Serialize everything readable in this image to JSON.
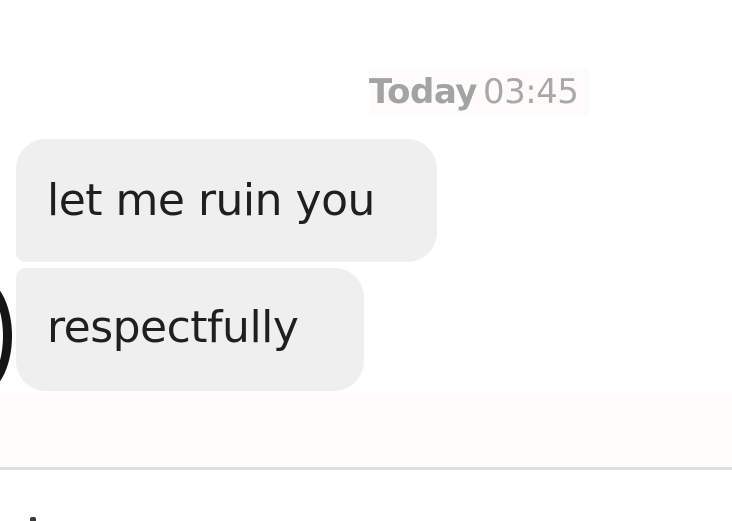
{
  "conversation": {
    "timestamp": {
      "day": "Today",
      "time": "03:45"
    },
    "messages": [
      {
        "text": "let me ruin you"
      },
      {
        "text": "respectfully"
      }
    ]
  },
  "colors": {
    "incoming_bubble": "#efefef",
    "message_text": "#1f1f1f",
    "timestamp_text": "#a3a3a3",
    "divider": "#dedede"
  },
  "icons": {
    "avatar": "contact-avatar"
  }
}
